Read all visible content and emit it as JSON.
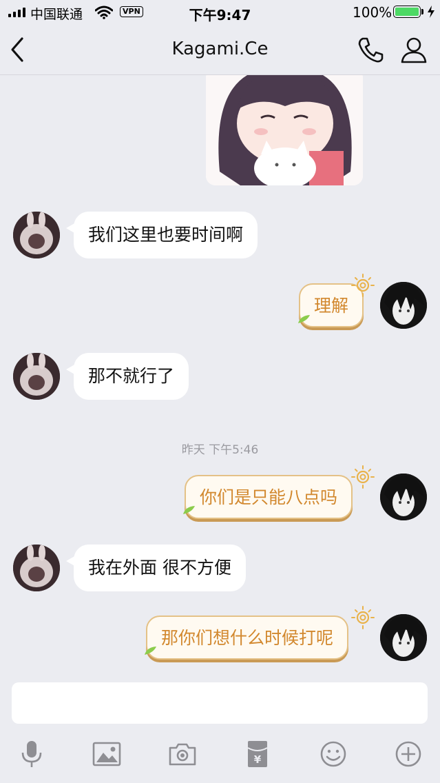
{
  "status_bar": {
    "carrier": "中国联通",
    "vpn": "VPN",
    "time": "下午9:47",
    "battery": "100%",
    "battery_level": 1.0
  },
  "nav": {
    "title": "Kagami.Ce"
  },
  "chat": {
    "messages": [
      {
        "from": "other",
        "text": "我们这里也要时间啊"
      },
      {
        "from": "self",
        "text": "理解"
      },
      {
        "from": "other",
        "text": "那不就行了"
      },
      {
        "from": "self",
        "text": "你们是只能八点吗"
      },
      {
        "from": "other",
        "text": "我在外面 很不方便"
      },
      {
        "from": "self",
        "text": "那你们想什么时候打呢"
      }
    ],
    "timestamp": "昨天 下午5:46"
  },
  "input": {
    "value": ""
  },
  "toolbar": {
    "items": [
      "mic-icon",
      "image-icon",
      "camera-icon",
      "red-packet-icon",
      "emoji-icon",
      "plus-icon"
    ]
  },
  "colors": {
    "background": "#ebecf1",
    "self_bubble_text": "#d2882e",
    "self_bubble_border": "#e4c186",
    "battery_fill": "#4cd964"
  }
}
